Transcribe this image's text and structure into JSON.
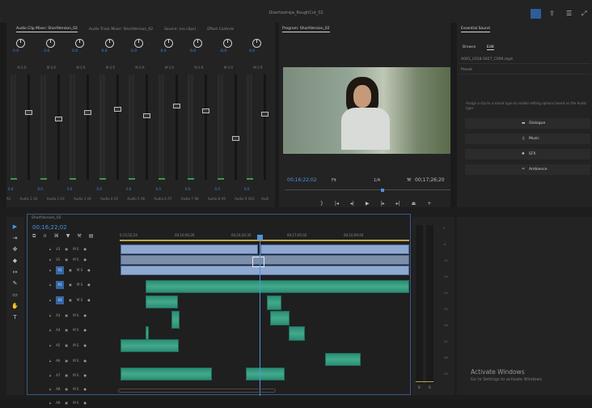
{
  "app": {
    "window_title": "Disertasiraja_RoughCut_02"
  },
  "mixer": {
    "tabs": [
      {
        "label": "Audio Clip Mixer: ShortVersion_02",
        "active": true
      },
      {
        "label": "Audio Track Mixer: ShortVersion_02",
        "active": false
      },
      {
        "label": "Source: (no clips)",
        "active": false
      },
      {
        "label": "Effect Controls",
        "active": false
      }
    ],
    "channel_values": [
      "0.0",
      "-3.0",
      "0.0",
      "0.0",
      "0.0",
      "0.0",
      "0.0",
      "-6.0",
      "0.0"
    ],
    "msr": "M S R",
    "footer_value": "0.0",
    "labels": [
      "A1",
      "Audio 1",
      "A2",
      "Audio 2",
      "A3",
      "Audio 3",
      "A4",
      "Audio 4",
      "A5",
      "Audio 5",
      "A6",
      "Audio 6",
      "A7",
      "Audio 7",
      "A8",
      "Audio 8",
      "A9",
      "Audio 9",
      "A10",
      "Audi"
    ],
    "ticks": [
      "0",
      "-3",
      "-6",
      "-9",
      "-12",
      "-15",
      "-18",
      "-24",
      "-30",
      "-inf"
    ]
  },
  "program": {
    "tab": "Program: ShortVersion_02",
    "timecode_current": "00;16;22;02",
    "fit": "Fit",
    "quality": "1/4",
    "timecode_total": "00;17;26;20"
  },
  "essential_sound": {
    "tab": "Essential Sound",
    "browse": "Browse",
    "edit": "Edit",
    "clip_name": "A001_C018 0427_C006.mp4",
    "preset_label": "Preset",
    "hint": "Assign a clip to a sound type to enable editing options based on the Audio type",
    "types": [
      {
        "icon": "dialogue-icon",
        "label": "Dialogue"
      },
      {
        "icon": "music-icon",
        "label": "Music"
      },
      {
        "icon": "sfx-icon",
        "label": "SFX"
      },
      {
        "icon": "ambience-icon",
        "label": "Ambience"
      }
    ]
  },
  "timeline": {
    "tab": "ShortVersion_02",
    "timecode": "00;16;22;02",
    "ruler_labels": [
      "0;15;52;24",
      "00;16;06;26",
      "00;16;20;30",
      "00;17;05;02",
      "00;16;09;04"
    ],
    "track_labels": [
      "V3",
      "V2",
      "V1",
      "A1",
      "A2",
      "A3",
      "A4",
      "A5",
      "A6",
      "A7",
      "A8",
      "A9"
    ],
    "row_letters": "M S"
  },
  "levels": {
    "ticks": [
      "0",
      "-6",
      "-12",
      "-18",
      "-24",
      "-30",
      "-36",
      "-42",
      "-48",
      "-54"
    ],
    "footer": [
      "S",
      "S"
    ]
  },
  "watermark": {
    "line1": "Activate Windows",
    "line2": "Go to Settings to activate Windows"
  },
  "colors": {
    "accent": "#4d93e0",
    "video_clip": "#8fa8cf",
    "audio_clip": "#2b8d76",
    "target_track": "#3566a6"
  }
}
